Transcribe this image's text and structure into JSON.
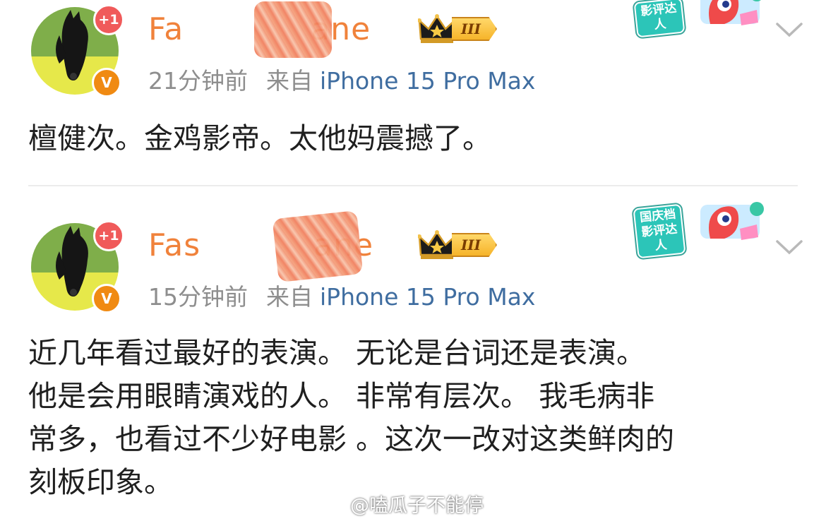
{
  "posts": [
    {
      "username": "Fashio",
      "username_visible": "Fas   ane",
      "follow_badge": "+1",
      "verified_badge": "V",
      "vip_level": "III",
      "time": "21分钟前",
      "from_label": "来自",
      "device": "iPhone 15 Pro Max",
      "sticker_text": "影评达人",
      "content_lines": [
        "檀健次。金鸡影帝。太他妈震撼了。"
      ]
    },
    {
      "username": "Fash",
      "username_visible": "Fas   ane",
      "follow_badge": "+1",
      "verified_badge": "V",
      "vip_level": "III",
      "time": "15分钟前",
      "from_label": "来自",
      "device": "iPhone 15 Pro Max",
      "sticker_text": "国庆档影评达人",
      "content_lines": [
        "近几年看过最好的表演。 无论是台词还是表演。",
        "他是会用眼睛演戏的人。 非常有层次。 我毛病非",
        "常多，也看过不少好电影 。这次一改对这类鲜肉的",
        "刻板印象。"
      ]
    }
  ],
  "name_parts": {
    "post1_left": "Fa",
    "post1_right": "ane",
    "post2_left": "Fas",
    "post2_right": "ane"
  },
  "sticker_texts": {
    "post1": "影评达人",
    "post2_line1": "国庆档",
    "post2_line2": "影评达人"
  },
  "watermark": "@嗑瓜子不能停",
  "colors": {
    "username": "#f0823b",
    "device_link": "#3f6da0",
    "meta": "#8e8e8e",
    "follow_badge": "#f05a5a",
    "verified_badge": "#f08a12"
  }
}
